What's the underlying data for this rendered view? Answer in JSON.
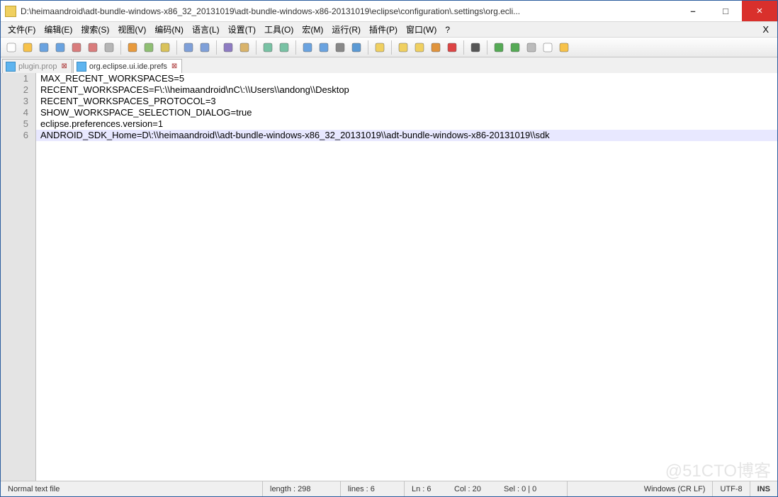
{
  "titlebar": {
    "path": "D:\\heimaandroid\\adt-bundle-windows-x86_32_20131019\\adt-bundle-windows-x86-20131019\\eclipse\\configuration\\.settings\\org.ecli..."
  },
  "window_controls": {
    "min": "–",
    "max": "□",
    "close": "×"
  },
  "menu": {
    "file": "文件(F)",
    "edit": "编辑(E)",
    "search": "搜索(S)",
    "view": "视图(V)",
    "encoding": "编码(N)",
    "language": "语言(L)",
    "settings": "设置(T)",
    "tools": "工具(O)",
    "macro": "宏(M)",
    "run": "运行(R)",
    "plugins": "插件(P)",
    "window": "窗口(W)",
    "help": "?",
    "close": "X"
  },
  "tabs": [
    {
      "label": "plugin.prop",
      "active": false
    },
    {
      "label": "org.eclipse.ui.ide.prefs",
      "active": true
    }
  ],
  "lines": [
    "MAX_RECENT_WORKSPACES=5",
    "RECENT_WORKSPACES=F\\:\\\\heimaandroid\\nC\\:\\\\Users\\\\andong\\\\Desktop",
    "RECENT_WORKSPACES_PROTOCOL=3",
    "SHOW_WORKSPACE_SELECTION_DIALOG=true",
    "eclipse.preferences.version=1",
    "ANDROID_SDK_Home=D\\:\\\\heimaandroid\\\\adt-bundle-windows-x86_32_20131019\\\\adt-bundle-windows-x86-20131019\\\\sdk"
  ],
  "highlight_line": 6,
  "status": {
    "file_type": "Normal text file",
    "length": "length : 298",
    "lines": "lines : 6",
    "ln": "Ln : 6",
    "col": "Col : 20",
    "sel": "Sel : 0 | 0",
    "eol": "Windows (CR LF)",
    "enc": "UTF-8",
    "mode": "INS"
  },
  "toolbar_icons": [
    "new-file-icon",
    "open-file-icon",
    "save-icon",
    "save-all-icon",
    "close-icon",
    "close-all-icon",
    "print-icon",
    "sep",
    "cut-icon",
    "copy-icon",
    "paste-icon",
    "sep",
    "undo-icon",
    "redo-icon",
    "sep",
    "find-icon",
    "replace-icon",
    "sep",
    "zoom-in-icon",
    "zoom-out-icon",
    "sep",
    "sync-v-icon",
    "sync-h-icon",
    "wrap-icon",
    "all-chars-icon",
    "sep",
    "indent-guide-icon",
    "sep",
    "lang-icon",
    "doc-map-icon",
    "function-list-icon",
    "folder-icon",
    "sep",
    "monitor-icon",
    "sep",
    "record-icon",
    "stop-icon",
    "play-icon",
    "play-multi-icon",
    "save-macro-icon"
  ],
  "watermark": "@51CTO博客"
}
